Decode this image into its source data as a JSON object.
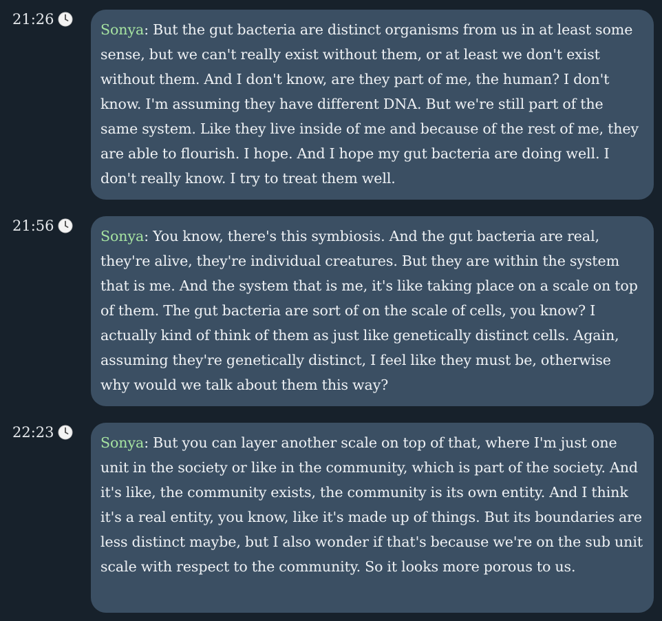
{
  "messages": [
    {
      "time": "21:26",
      "icon": "clock-icon",
      "speaker": "Sonya",
      "separator": ": ",
      "text": "But the gut bacteria are distinct organisms from us in at least some sense, but we can't really exist without them, or at least we don't exist without them. And I don't know, are they part of me, the human? I don't know. I'm assuming they have different DNA. But we're still part of the same system. Like they live inside of me and because of the rest of me, they are able to flourish. I hope. And I hope my gut bacteria are doing well. I don't really know. I try to treat them well."
    },
    {
      "time": "21:56",
      "icon": "clock-icon",
      "speaker": "Sonya",
      "separator": ": ",
      "text": "You know, there's this symbiosis. And the gut bacteria are real, they're alive, they're individual creatures. But they are within the system that is me. And the system that is me, it's like taking place on a scale on top of them. The gut bacteria are sort of on the scale of cells, you know? I actually kind of think of them as just like genetically distinct cells. Again, assuming they're genetically distinct, I feel like they must be, otherwise why would we talk about them this way?"
    },
    {
      "time": "22:23",
      "icon": "clock-icon",
      "speaker": "Sonya",
      "separator": ": ",
      "text": "But you can layer another scale on top of that, where I'm just one unit in the society or like in the community, which is part of the society. And it's like, the community exists, the community is its own entity. And I think it's a real entity, you know, like it's made up of things. But its boundaries are less distinct maybe, but I also wonder if that's because we're on the sub unit scale with respect to the community. So it looks more porous to us."
    }
  ],
  "colors": {
    "background": "#17212b",
    "bubble": "#3b4f63",
    "speaker": "#a6e3a1",
    "text": "#eef1f4"
  }
}
